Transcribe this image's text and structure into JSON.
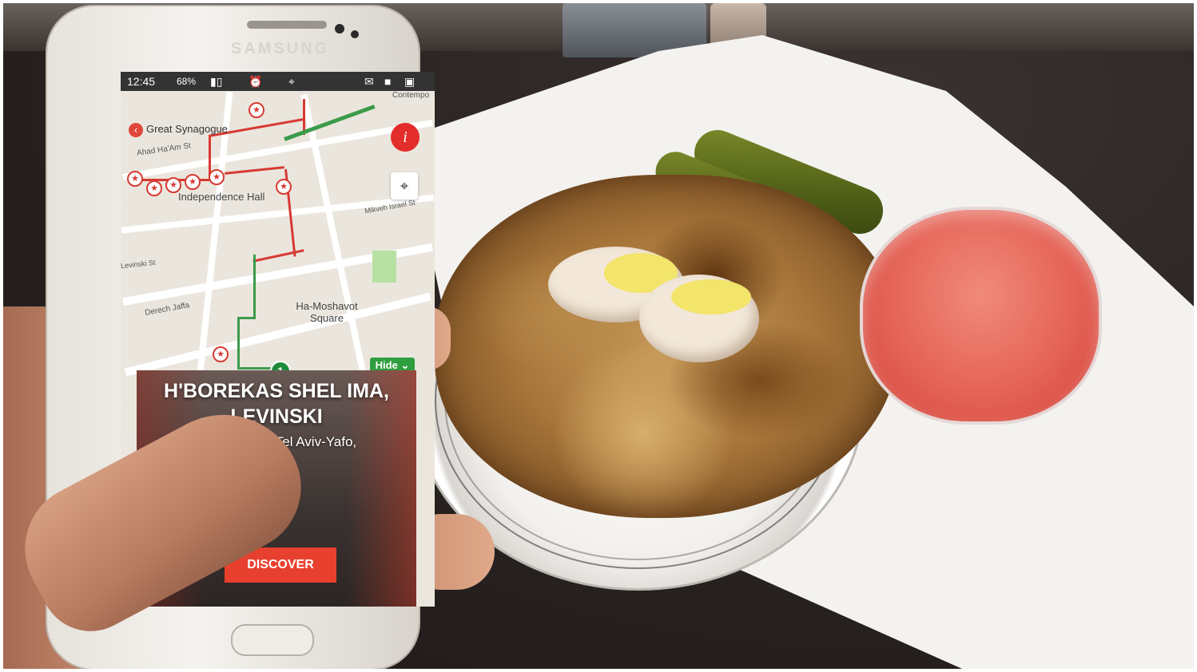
{
  "phone": {
    "brand": "SAMSUNG",
    "status_bar": {
      "time": "12:45",
      "battery": "68%"
    },
    "map": {
      "back_label": "Great Synagogue",
      "labels": [
        "Ahad Ha'Am St",
        "Independence Hall",
        "Mikveh Israel St",
        "Ha-Moshavot Square",
        "Derech Jaffa",
        "Levinski St",
        "Contempo"
      ],
      "info_button": "i",
      "hide_button": "Hide",
      "user_marker": "1",
      "route_colors": {
        "visited": "#d73a33",
        "upcoming": "#3b9b4a"
      }
    },
    "card": {
      "title": "H'BOREKAS SHEL IMA, LEVINSKI",
      "address": "Levinsky 46, Tel Aviv-Yafo,",
      "cta": "DISCOVER"
    }
  }
}
